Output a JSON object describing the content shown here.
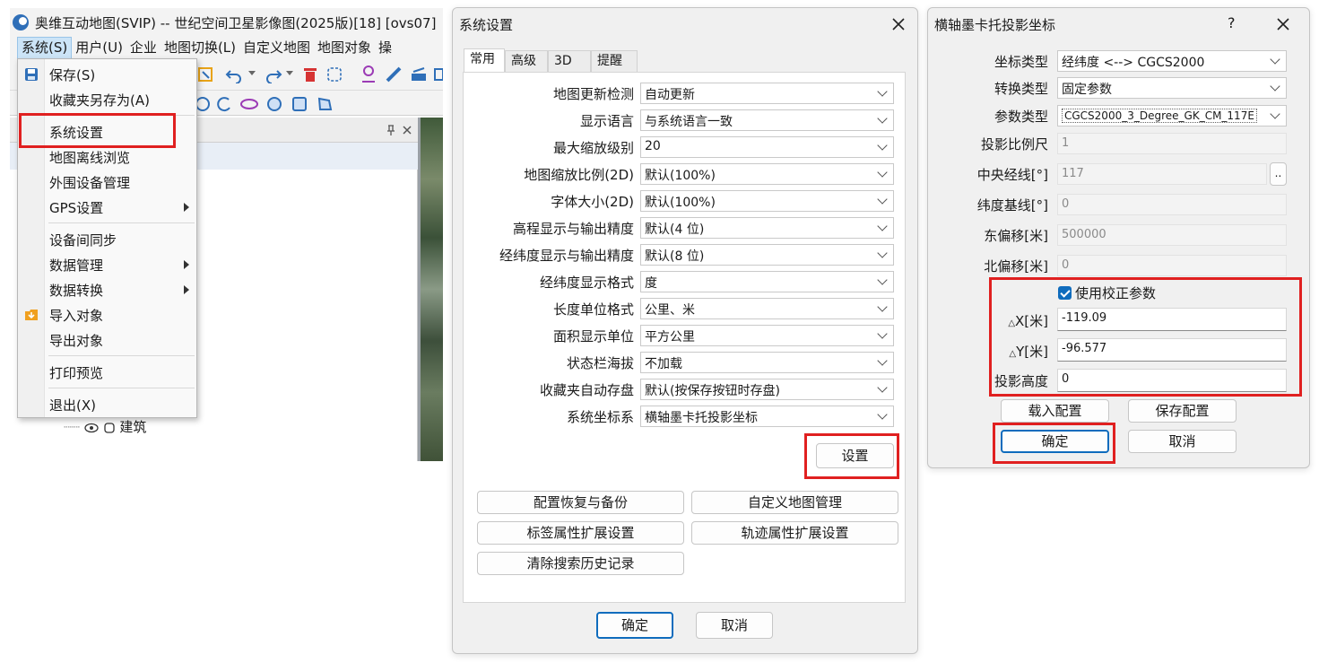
{
  "colors": {
    "accent": "#0f6cbd",
    "highlight": "#e02020",
    "menu_active": "#cce4f7"
  },
  "main_window": {
    "title": "奥维互动地图(SVIP) -- 世纪空间卫星影像图(2025版)[18] [ovs07]",
    "menubar": [
      "系统(S)",
      "用户(U)",
      "企业",
      "地图切换(L)",
      "自定义地图",
      "地图对象",
      "操"
    ],
    "tree_item": "建筑",
    "system_menu": {
      "items": [
        {
          "label": "保存(S)",
          "icon": "save-icon"
        },
        {
          "label": "收藏夹另存为(A)"
        },
        {
          "label": "系统设置",
          "highlighted": true
        },
        {
          "label": "地图离线浏览"
        },
        {
          "label": "外围设备管理"
        },
        {
          "label": "GPS设置",
          "submenu": true
        },
        {
          "label": "设备间同步"
        },
        {
          "label": "数据管理",
          "submenu": true
        },
        {
          "label": "数据转换",
          "submenu": true
        },
        {
          "label": "导入对象",
          "icon": "import-folder-icon"
        },
        {
          "label": "导出对象"
        },
        {
          "label": "打印预览"
        },
        {
          "label": "退出(X)"
        }
      ]
    }
  },
  "settings_dialog": {
    "title": "系统设置",
    "tabs": [
      "常用",
      "高级",
      "3D",
      "提醒"
    ],
    "rows": [
      {
        "label": "地图更新检测",
        "value": "自动更新"
      },
      {
        "label": "显示语言",
        "value": "与系统语言一致"
      },
      {
        "label": "最大缩放级别",
        "value": "20"
      },
      {
        "label": "地图缩放比例(2D)",
        "value": "默认(100%)"
      },
      {
        "label": "字体大小(2D)",
        "value": "默认(100%)"
      },
      {
        "label": "高程显示与输出精度",
        "value": "默认(4 位)"
      },
      {
        "label": "经纬度显示与输出精度",
        "value": "默认(8 位)"
      },
      {
        "label": "经纬度显示格式",
        "value": "度"
      },
      {
        "label": "长度单位格式",
        "value": "公里、米"
      },
      {
        "label": "面积显示单位",
        "value": "平方公里"
      },
      {
        "label": "状态栏海拔",
        "value": "不加载"
      },
      {
        "label": "收藏夹自动存盘",
        "value": "默认(按保存按钮时存盘)"
      },
      {
        "label": "系统坐标系",
        "value": "横轴墨卡托投影坐标"
      }
    ],
    "set_button": "设置",
    "action_buttons": [
      "配置恢复与备份",
      "自定义地图管理",
      "标签属性扩展设置",
      "轨迹属性扩展设置",
      "清除搜索历史记录"
    ],
    "ok": "确定",
    "cancel": "取消"
  },
  "projection_dialog": {
    "title": "横轴墨卡托投影坐标",
    "help": "?",
    "fields": {
      "coord_type": {
        "label": "坐标类型",
        "value": "经纬度 <--> CGCS2000"
      },
      "convert_type": {
        "label": "转换类型",
        "value": "固定参数"
      },
      "param_type": {
        "label": "参数类型",
        "value": "CGCS2000_3_Degree_GK_CM_117E"
      },
      "scale": {
        "label": "投影比例尺",
        "value": "1"
      },
      "central_meridian": {
        "label": "中央经线[°]",
        "value": "117",
        "button": ".."
      },
      "lat_base": {
        "label": "纬度基线[°]",
        "value": "0"
      },
      "false_east": {
        "label": "东偏移[米]",
        "value": "500000"
      },
      "false_north": {
        "label": "北偏移[米]",
        "value": "0"
      }
    },
    "correction": {
      "checkbox_label": "使用校正参数",
      "checked": true,
      "dx": {
        "label": "X[米]",
        "value": "-119.09"
      },
      "dy": {
        "label": "Y[米]",
        "value": "-96.577"
      },
      "height": {
        "label": "投影高度",
        "value": "0"
      }
    },
    "load_config": "载入配置",
    "save_config": "保存配置",
    "ok": "确定",
    "cancel": "取消"
  }
}
